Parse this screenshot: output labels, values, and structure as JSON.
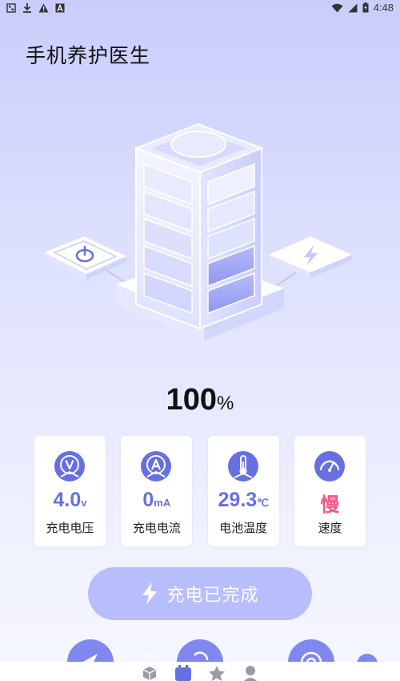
{
  "status_bar": {
    "left_icons": [
      "notification-app-icon",
      "download-icon",
      "warning-icon",
      "app-a-icon"
    ],
    "right_icons": [
      "wifi-icon",
      "signal-icon",
      "battery-icon"
    ],
    "time": "4:48"
  },
  "app": {
    "title": "手机养护医生"
  },
  "battery": {
    "percent_value": "100",
    "percent_unit": "%",
    "level": 1.0
  },
  "stats": [
    {
      "icon": "voltage-icon",
      "value": "4.0",
      "unit": "v",
      "label": "充电电压"
    },
    {
      "icon": "current-icon",
      "value": "0",
      "unit": "mA",
      "label": "充电电流"
    },
    {
      "icon": "thermometer-icon",
      "value": "29.3",
      "unit": "℃",
      "label": "电池温度"
    },
    {
      "icon": "speedometer-icon",
      "value": "慢",
      "unit": "",
      "label": "速度"
    }
  ],
  "charge_button": {
    "icon": "lightning-icon",
    "label": "充电已完成"
  },
  "bottom_nav": {
    "items": [
      "box-icon",
      "battery-nav-icon",
      "star-icon",
      "profile-icon"
    ],
    "active_index": 1
  },
  "colors": {
    "accent": "#6670e0",
    "slow": "#f0558a",
    "button": "#b8befb",
    "title": "#111111"
  }
}
